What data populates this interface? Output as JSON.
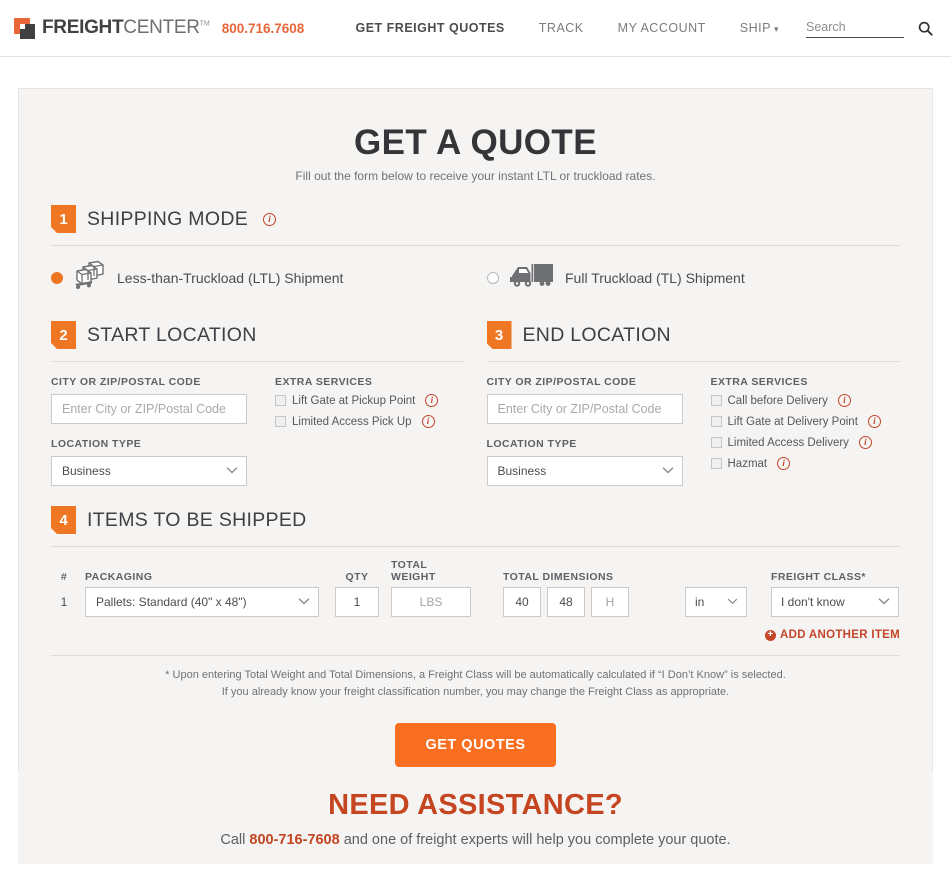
{
  "header": {
    "logo": {
      "bold": "FREIGHT",
      "light": "CENTER",
      "tm": "TM",
      "mark": "logo-square-icon"
    },
    "phone": "800.716.7608",
    "nav": [
      {
        "label": "GET FREIGHT QUOTES",
        "active": true,
        "caret": false
      },
      {
        "label": "TRACK",
        "active": false,
        "caret": false
      },
      {
        "label": "MY ACCOUNT",
        "active": false,
        "caret": false
      },
      {
        "label": "SHIP",
        "active": false,
        "caret": true
      }
    ],
    "search": {
      "value": "",
      "placeholder": "Search",
      "icon": "search-icon"
    }
  },
  "quote": {
    "title": "GET A QUOTE",
    "subtitle": "Fill out the form below to receive your instant LTL or truckload rates.",
    "step1": {
      "number": "1",
      "title": "SHIPPING MODE",
      "info": "i",
      "modes": [
        {
          "label": "Less-than-Truckload (LTL) Shipment",
          "selected": true,
          "icon": "pallet-jack-icon"
        },
        {
          "label": "Full Truckload (TL) Shipment",
          "selected": false,
          "icon": "semi-truck-icon"
        }
      ]
    },
    "step2": {
      "number": "2",
      "title": "START LOCATION",
      "city_label": "CITY OR ZIP/POSTAL CODE",
      "city_value": "",
      "city_placeholder": "Enter City or ZIP/Postal Code",
      "location_type_label": "LOCATION TYPE",
      "location_type_value": "Business",
      "extra_label": "EXTRA SERVICES",
      "extras": [
        {
          "label": "Lift Gate at Pickup Point",
          "checked": false
        },
        {
          "label": "Limited Access Pick Up",
          "checked": false
        }
      ]
    },
    "step3": {
      "number": "3",
      "title": "END LOCATION",
      "city_label": "CITY OR ZIP/POSTAL CODE",
      "city_value": "",
      "city_placeholder": "Enter City or ZIP/Postal Code",
      "location_type_label": "LOCATION TYPE",
      "location_type_value": "Business",
      "extra_label": "EXTRA SERVICES",
      "extras": [
        {
          "label": "Call before Delivery",
          "checked": false
        },
        {
          "label": "Lift Gate at Delivery Point",
          "checked": false
        },
        {
          "label": "Limited Access Delivery",
          "checked": false
        },
        {
          "label": "Hazmat",
          "checked": false
        }
      ]
    },
    "step4": {
      "number": "4",
      "title": "ITEMS TO BE SHIPPED",
      "columns": {
        "num": "#",
        "packaging": "PACKAGING",
        "qty": "QTY",
        "weight": "TOTAL WEIGHT",
        "dimensions": "TOTAL DIMENSIONS",
        "freight_class": "FREIGHT CLASS*"
      },
      "row": {
        "num": "1",
        "packaging": "Pallets: Standard (40\" x 48\")",
        "qty": "1",
        "weight_value": "",
        "weight_placeholder": "LBS",
        "dim_length": "40",
        "dim_width": "48",
        "dim_height_value": "",
        "dim_height_placeholder": "H",
        "unit": "in",
        "freight_class": "I don't know"
      },
      "add_item": "ADD ANOTHER ITEM"
    },
    "note_line1": "* Upon entering Total Weight and Total Dimensions, a Freight Class will be automatically calculated if “I Don’t Know” is selected.",
    "note_line2": "If you already know your freight classification number, you may change the Freight Class as appropriate.",
    "cta": "GET QUOTES"
  },
  "assistance": {
    "title": "NEED ASSISTANCE?",
    "call_prefix": "Call ",
    "phone": "800-716-7608",
    "call_suffix": " and one of freight experts will help you complete your quote."
  },
  "colors": {
    "orange": "#ef7622",
    "cta_orange": "#f96e20",
    "logo_orange": "#e8673a",
    "red": "#c4452a",
    "assist_red": "#c4451f",
    "card_bg": "#f5f4f3",
    "text_dark": "#3d4044",
    "text_muted": "#6f7276"
  }
}
